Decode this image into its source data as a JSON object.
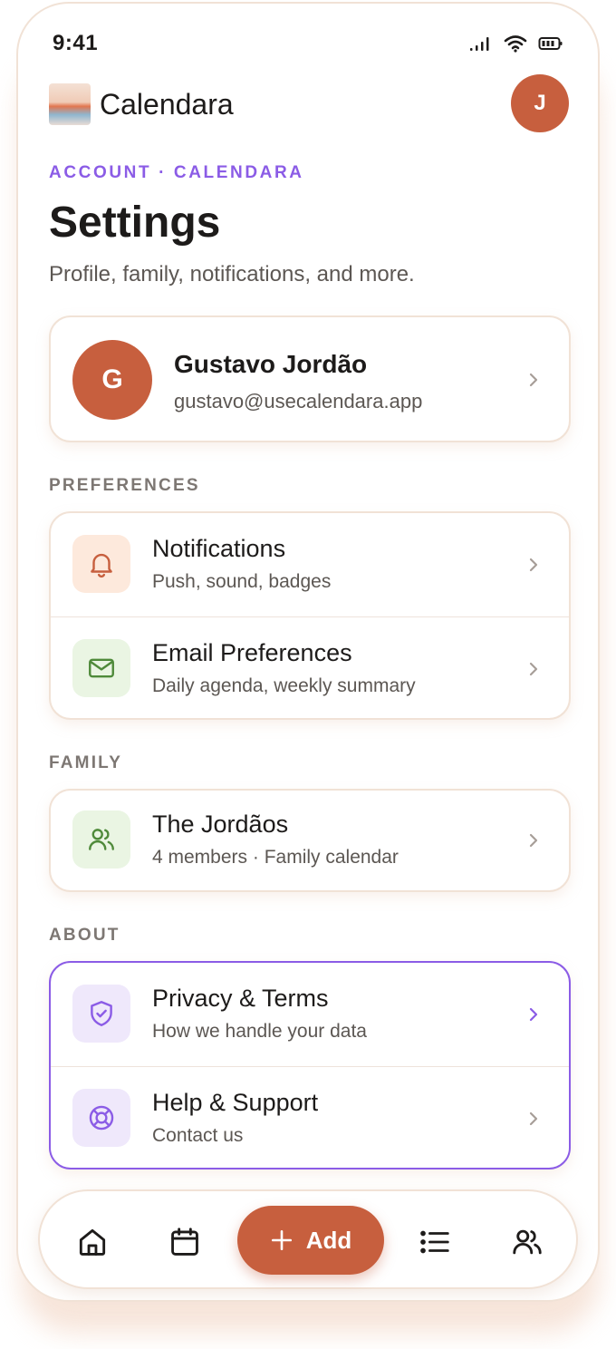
{
  "status_bar": {
    "time": "9:41"
  },
  "app": {
    "name": "Calendara",
    "avatar_initial": "J"
  },
  "header": {
    "eyebrow": "ACCOUNT · CALENDARA",
    "title": "Settings",
    "subtitle": "Profile, family, notifications, and more."
  },
  "profile": {
    "initial": "G",
    "name": "Gustavo Jordão",
    "email": "gustavo@usecalendara.app"
  },
  "sections": {
    "preferences": {
      "label": "PREFERENCES",
      "items": [
        {
          "title": "Notifications",
          "subtitle": "Push, sound, badges",
          "icon": "bell-icon"
        },
        {
          "title": "Email Preferences",
          "subtitle": "Daily agenda, weekly summary",
          "icon": "mail-icon"
        }
      ]
    },
    "family": {
      "label": "FAMILY",
      "items": [
        {
          "title": "The Jordãos",
          "subtitle": "4 members · Family calendar",
          "icon": "users-icon"
        }
      ]
    },
    "about": {
      "label": "ABOUT",
      "items": [
        {
          "title": "Privacy & Terms",
          "subtitle": "How we handle your data",
          "icon": "shield-check-icon"
        },
        {
          "title": "Help & Support",
          "subtitle": "Contact us",
          "icon": "lifebuoy-icon"
        }
      ]
    }
  },
  "bottom_nav": {
    "add_label": "Add",
    "items": [
      "home-icon",
      "calendar-icon",
      "list-icon",
      "users-icon"
    ]
  },
  "colors": {
    "accent": "#c75f3e",
    "purple": "#8b5ce6",
    "border": "#f1e2d6"
  }
}
